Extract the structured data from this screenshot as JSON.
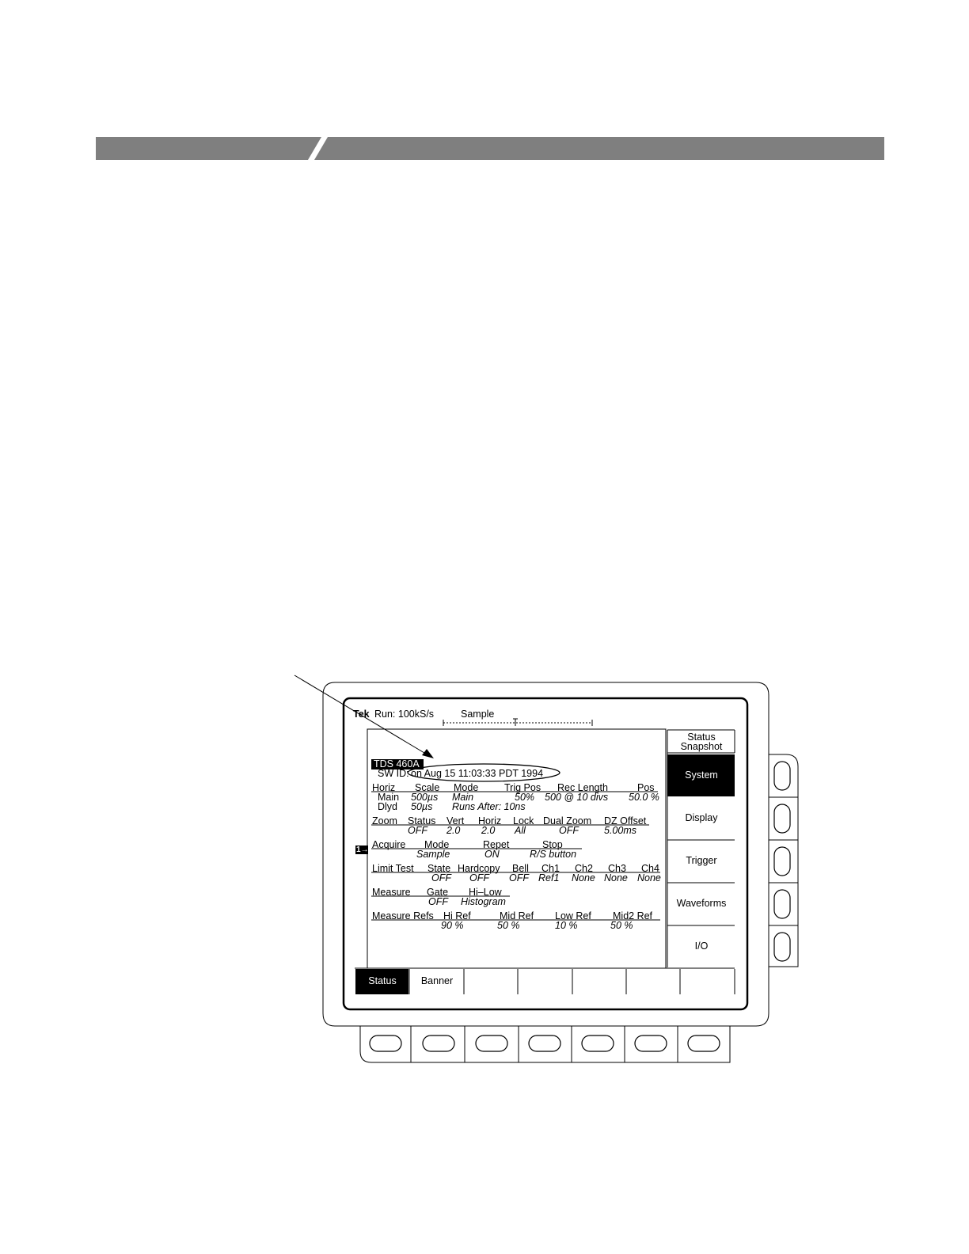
{
  "screen": {
    "brand": "Tek",
    "run_status": "Run: 100kS/s",
    "acq_mode": "Sample",
    "model": "TDS 460A",
    "sw_id_label": "SW ID:",
    "sw_id_value": "on Aug 15 11:03:33 PDT 1994",
    "channel_marker": "1→",
    "horiz": {
      "headers": [
        "Horiz",
        "Scale",
        "Mode",
        "Trig Pos",
        "Rec Length",
        "Pos"
      ],
      "main": [
        "Main",
        "500µs",
        "Main",
        "50%",
        "500  @ 10 divs",
        "50.0 %"
      ],
      "dlyd": [
        "Dlyd",
        "50µs",
        "Runs After: 10ns"
      ]
    },
    "zoom": {
      "headers": [
        "Zoom",
        "Status",
        "Vert",
        "Horiz",
        "Lock",
        "Dual Zoom",
        "DZ Offset"
      ],
      "values": [
        "OFF",
        "2.0",
        "2.0",
        "All",
        "OFF",
        "5.00ms"
      ]
    },
    "acquire": {
      "headers": [
        "Acquire",
        "Mode",
        "Repet",
        "Stop"
      ],
      "values": [
        "Sample",
        "ON",
        "R/S button"
      ]
    },
    "limit": {
      "headers": [
        "Limit Test",
        "State",
        "Hardcopy",
        "Bell",
        "Ch1",
        "Ch2",
        "Ch3",
        "Ch4"
      ],
      "values": [
        "OFF",
        "OFF",
        "OFF",
        "Ref1",
        "None",
        "None",
        "None"
      ]
    },
    "measure": {
      "headers": [
        "Measure",
        "Gate",
        "Hi–Low"
      ],
      "values": [
        "OFF",
        "Histogram"
      ]
    },
    "refs": {
      "headers": [
        "Measure Refs",
        "Hi Ref",
        "Mid Ref",
        "Low Ref",
        "Mid2 Ref"
      ],
      "values": [
        "90 %",
        "50 %",
        "10 %",
        "50 %"
      ]
    },
    "side_menu": {
      "title_line1": "Status",
      "title_line2": "Snapshot",
      "items": [
        "System",
        "Display",
        "Trigger",
        "Waveforms",
        "I/O"
      ]
    },
    "bottom_menu": [
      "Status",
      "Banner",
      "",
      "",
      "",
      "",
      ""
    ]
  }
}
